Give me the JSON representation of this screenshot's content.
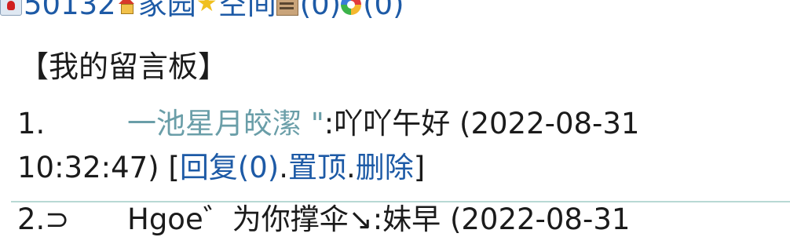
{
  "nav": {
    "qq_number": "50132",
    "home_label": "家园",
    "space_label": "空间",
    "count1": "(0)",
    "count2": "(0)"
  },
  "board": {
    "title": "【我的留言板】"
  },
  "messages": [
    {
      "index": "1.",
      "nickname": "一池星月皎潔 \"",
      "text": ":吖吖午好 (2022-08-31",
      "time_rest": "10:32:47) [",
      "reply_label": "回复(0)",
      "sep1": ".",
      "top_label": "置顶",
      "sep2": ".",
      "delete_label": "删除",
      "close": "]"
    },
    {
      "index": "2.⊃",
      "nickname": "Hgoe゛为你撑伞↘",
      "text": ":妹早 (2022-08-31"
    }
  ],
  "colors": {
    "link": "#1d5aa6",
    "nickname": "#6a9ea8",
    "divider": "#b8d9d4"
  },
  "icons": [
    "qq-icon",
    "home-icon",
    "star-icon",
    "building-icon",
    "circle-icon"
  ]
}
